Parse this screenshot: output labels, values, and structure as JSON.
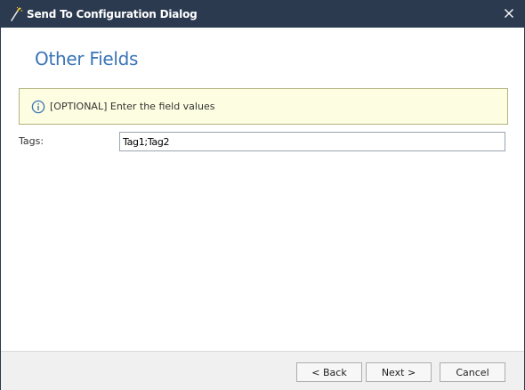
{
  "window": {
    "title": "Send To Configuration Dialog",
    "title_icon": "wand-icon",
    "close_icon": "close-icon"
  },
  "page": {
    "title": "Other Fields"
  },
  "info": {
    "icon": "info-icon",
    "text": "[OPTIONAL] Enter the field values"
  },
  "fields": {
    "tags": {
      "label": "Tags:",
      "value": "Tag1;Tag2"
    }
  },
  "footer": {
    "back_label": "< Back",
    "next_label": "Next >",
    "cancel_label": "Cancel"
  },
  "colors": {
    "titlebar": "#2b3a4f",
    "page_title": "#3a74b6",
    "info_background": "#fdfde1",
    "info_border": "#b3b37f",
    "footer": "#f0f0f0"
  }
}
